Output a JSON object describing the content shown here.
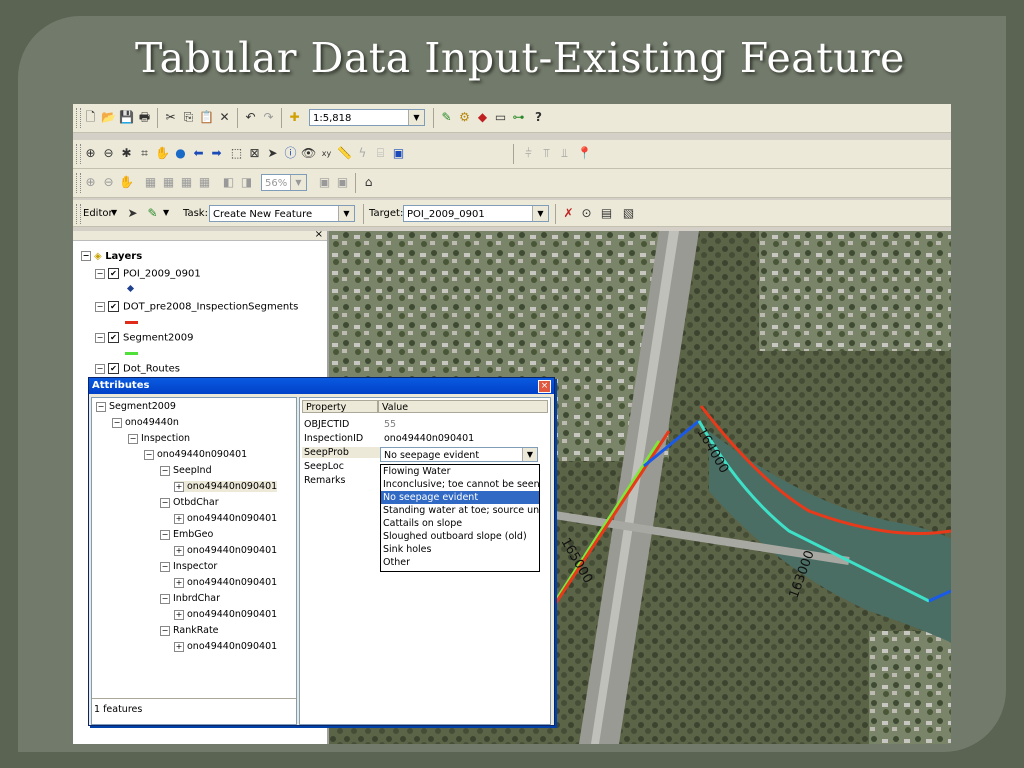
{
  "slide": {
    "title": "Tabular Data Input-Existing Feature"
  },
  "toolbar": {
    "scale_value": "1:5,818",
    "zoom_value": "56%",
    "editor_label": "Editor",
    "task_label": "Task:",
    "task_value": "Create New Feature",
    "target_label": "Target:",
    "target_value": "POI_2009_0901"
  },
  "toc": {
    "root_label": "Layers",
    "layers": [
      {
        "name": "POI_2009_0901",
        "symbol_color": "#1f3f8f"
      },
      {
        "name": "DOT_pre2008_InspectionSegments",
        "symbol_color": "#e02a1a"
      },
      {
        "name": "Segment2009",
        "symbol_color": "#4fe03a"
      },
      {
        "name": "Dot_Routes"
      }
    ]
  },
  "attributes": {
    "title": "Attributes",
    "tree": {
      "root": "Segment2009",
      "feature": "ono49440n",
      "inspection": "Inspection",
      "record": "ono49440n090401",
      "groups": [
        {
          "name": "SeepInd",
          "child": "ono49440n090401"
        },
        {
          "name": "OtbdChar",
          "child": "ono49440n090401"
        },
        {
          "name": "EmbGeo",
          "child": "ono49440n090401"
        },
        {
          "name": "Inspector",
          "child": "ono49440n090401"
        },
        {
          "name": "InbrdChar",
          "child": "ono49440n090401"
        },
        {
          "name": "RankRate",
          "child": "ono49440n090401"
        }
      ]
    },
    "feature_count": "1 features",
    "grid": {
      "col_property": "Property",
      "col_value": "Value",
      "rows": [
        {
          "property": "OBJECTID",
          "value": "55"
        },
        {
          "property": "InspectionID",
          "value": "ono49440n090401"
        },
        {
          "property": "SeepProb",
          "value": "No seepage evident"
        },
        {
          "property": "SeepLoc",
          "value": ""
        },
        {
          "property": "Remarks",
          "value": ""
        }
      ]
    },
    "dropdown": {
      "selected": "No seepage evident",
      "options": [
        "Flowing Water",
        "Inconclusive; toe cannot be seen",
        "No seepage evident",
        "Standing water at toe; source unknown",
        "Cattails on slope",
        "Sloughed outboard slope (old)",
        "Sink holes",
        "Other"
      ]
    }
  },
  "map": {
    "labels": [
      "164000",
      "165000",
      "163000"
    ],
    "colors": {
      "red": "#e83a1a",
      "cyan": "#3ee0c8",
      "blue": "#1a5ae8",
      "green": "#7ee83a",
      "river": "#4a6e64"
    }
  }
}
